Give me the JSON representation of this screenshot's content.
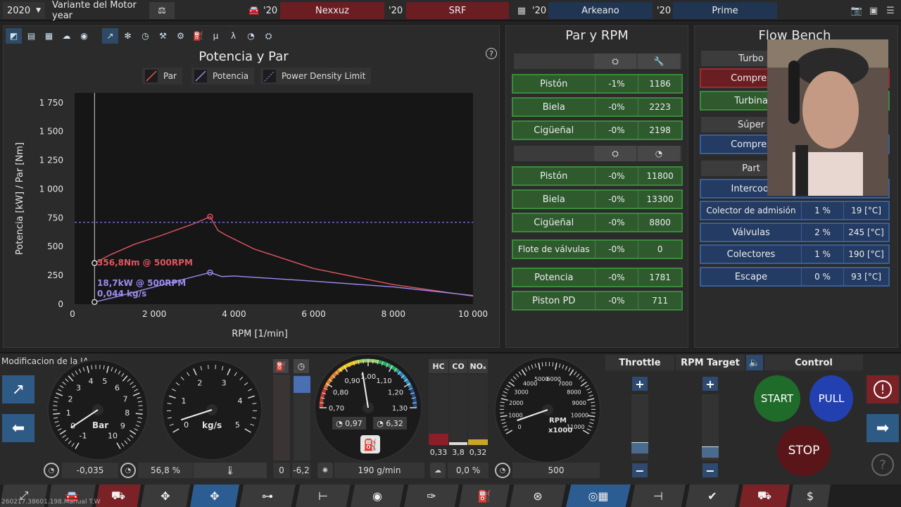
{
  "topbar": {
    "year": "2020",
    "variant_label": "Variante del Motor year",
    "car_year_1": "'20",
    "car_name_1": "Nexxuz",
    "car_year_2": "'20",
    "car_name_2": "SRF",
    "car_year_3": "'20",
    "car_name_3": "Arkeano",
    "car_year_4": "'20",
    "car_name_4": "Prime"
  },
  "chart": {
    "title": "Potencia y Par",
    "help": "?",
    "legend": [
      "Par",
      "Potencia",
      "Power Density Limit"
    ],
    "annotations": {
      "torque": "356,8Nm @ 500RPM",
      "power": "18,7kW @ 500RPM",
      "flow": "0,044 kg/s"
    }
  },
  "chart_data": {
    "type": "line",
    "title": "Potencia y Par",
    "xlabel": "RPM [1/min]",
    "ylabel": "Potencia [kW] / Par [Nm]",
    "xlim": [
      0,
      10000
    ],
    "ylim": [
      0,
      1750
    ],
    "x_ticks": [
      "0",
      "2 000",
      "4 000",
      "6 000",
      "8 000",
      "10 000"
    ],
    "y_ticks": [
      "0",
      "250",
      "500",
      "750",
      "1 000",
      "1 250",
      "1 500",
      "1 750"
    ],
    "legend_position": "top",
    "series": [
      {
        "name": "Par",
        "color": "#e05560",
        "x": [
          500,
          900,
          1500,
          2200,
          3000,
          3400,
          3600,
          3800,
          4500,
          6000,
          8000,
          10000
        ],
        "y": [
          357,
          430,
          520,
          600,
          700,
          760,
          640,
          600,
          480,
          310,
          170,
          70
        ]
      },
      {
        "name": "Potencia",
        "color": "#9a8cf0",
        "x": [
          500,
          1000,
          2000,
          3000,
          3400,
          3700,
          4000,
          6000,
          8000,
          10000
        ],
        "y": [
          19,
          60,
          150,
          240,
          275,
          240,
          245,
          200,
          150,
          75
        ]
      },
      {
        "name": "Power Density Limit",
        "color": "#6f6fd8",
        "x": [
          0,
          10000
        ],
        "y": [
          711,
          711
        ]
      }
    ]
  },
  "par_rpm": {
    "title": "Par y RPM",
    "rows_torque": [
      {
        "name": "Pistón",
        "pct": "-1%",
        "val": "1186"
      },
      {
        "name": "Biela",
        "pct": "-0%",
        "val": "2223"
      },
      {
        "name": "Cigüeñal",
        "pct": "-0%",
        "val": "2198"
      }
    ],
    "rows_rpm": [
      {
        "name": "Pistón",
        "pct": "-0%",
        "val": "11800"
      },
      {
        "name": "Biela",
        "pct": "-0%",
        "val": "13300"
      },
      {
        "name": "Cigüeñal",
        "pct": "-0%",
        "val": "8800"
      }
    ],
    "float": {
      "name": "Flote de válvulas",
      "pct": "-0%",
      "val": "0"
    },
    "power": {
      "name": "Potencia",
      "pct": "-0%",
      "val": "1781"
    },
    "piston_pd": {
      "name": "Piston PD",
      "pct": "-0%",
      "val": "711"
    }
  },
  "flow_bench": {
    "title": "Flow Bench",
    "turbo_label": "Turbo",
    "compresor": "Compres",
    "turbina": "Turbina",
    "super_label": "Súper",
    "super_compresor": "Compres",
    "part_label": "Part",
    "intercooler": "Intercool",
    "rows": [
      {
        "name": "Colector de admisión",
        "pct": "1 %",
        "temp": "19 [°C]"
      },
      {
        "name": "Válvulas",
        "pct": "2 %",
        "temp": "245 [°C]"
      },
      {
        "name": "Colectores",
        "pct": "1 %",
        "temp": "190 [°C]"
      },
      {
        "name": "Escape",
        "pct": "0 %",
        "temp": "93 [°C]"
      }
    ]
  },
  "bottom": {
    "ia_label": "Modificacion de la IA",
    "boost_gauge_unit": "Bar",
    "boost_ticks": [
      "-1",
      "0",
      "1",
      "2",
      "3",
      "4",
      "5",
      "6",
      "7",
      "8",
      "9",
      "10"
    ],
    "flow_gauge_unit": "kg/s",
    "flow_ticks": [
      "0",
      "1",
      "2",
      "3",
      "4",
      "5"
    ],
    "boost_readout": "-0,035",
    "throttle_readout": "56,8 %",
    "vert1_readout": "0",
    "vert2_readout": "-6,2",
    "lambda_ticks": [
      "0,70",
      "0,80",
      "0,90",
      "1,00",
      "1,10",
      "1,20",
      "1,30"
    ],
    "lambda_val_1": "0,97",
    "lambda_val_2": "6,32",
    "fuel_readout": "190 g/min",
    "emissions_heads": [
      "HC",
      "CO",
      "NOₓ"
    ],
    "emissions_vals": [
      "0,33",
      "3,8",
      "0,32"
    ],
    "emissions_readout": "0,0 %",
    "rpm_gauge_unit": "RPM",
    "rpm_gauge_mult": "x1000",
    "rpm_ticks": [
      "0",
      "1000",
      "2000",
      "3000",
      "4000",
      "5000",
      "6000",
      "7000",
      "8000",
      "9000",
      "10000",
      "11000"
    ],
    "rpm_readout": "500",
    "throttle_head": "Throttle",
    "rpm_target_head": "RPM Target",
    "control_head": "Control",
    "start": "START",
    "pull": "PULL",
    "stop": "STOP",
    "plus": "+",
    "minus": "−",
    "help": "?"
  },
  "watermark": "260217.38601.198.Manual T.W"
}
